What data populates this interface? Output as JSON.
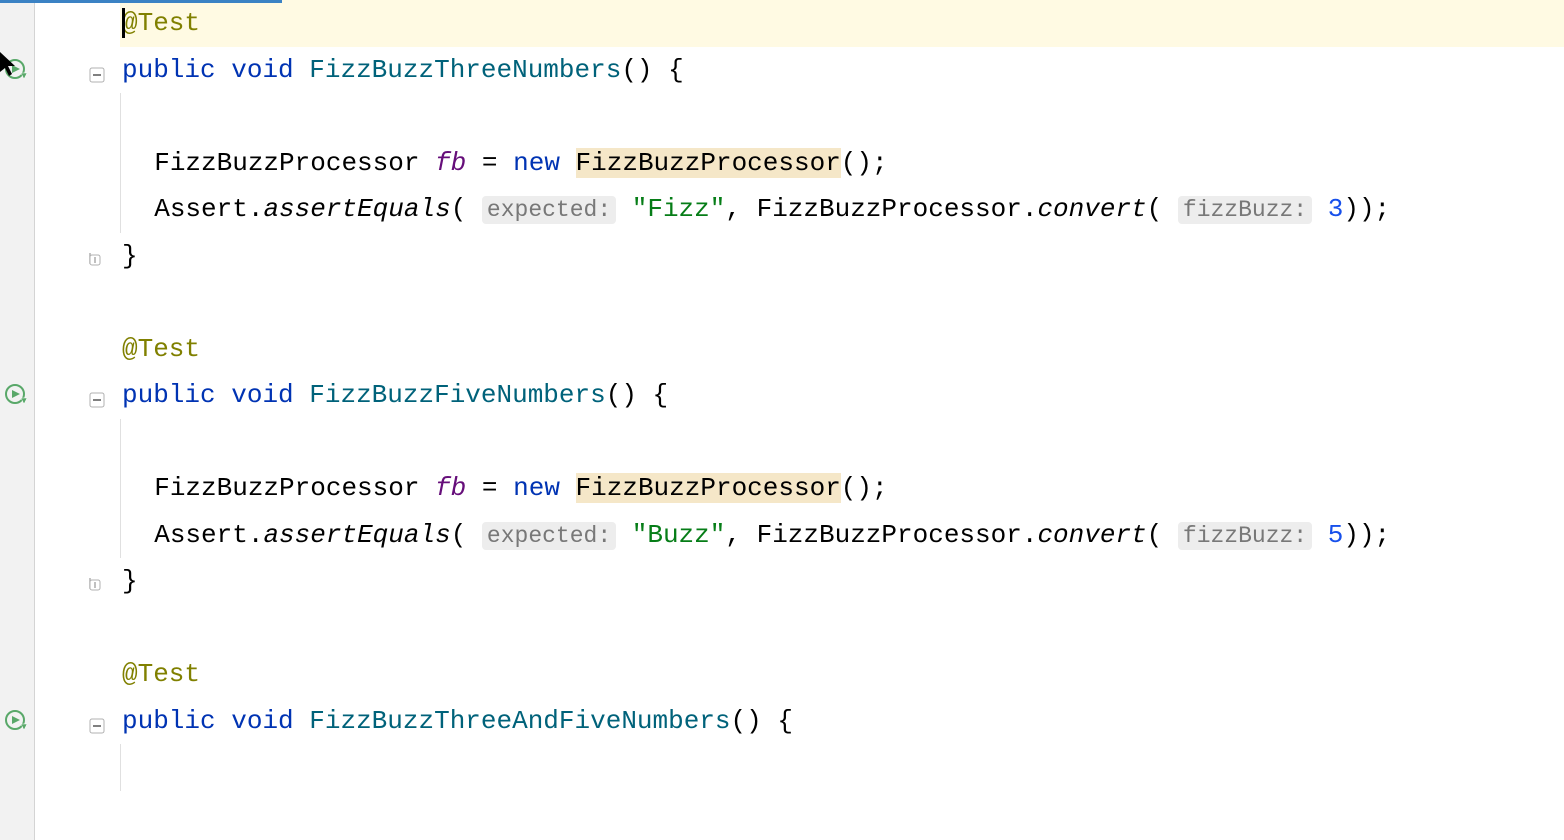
{
  "progress_percent": 18,
  "cursor_visible": true,
  "lines": [
    {
      "type": "annotation",
      "text": "@Test",
      "current": true,
      "caret": true,
      "indent": 0
    },
    {
      "type": "method_sig",
      "keywords": [
        "public",
        "void"
      ],
      "method": "FizzBuzzThreeNumbers",
      "suffix": "() {",
      "run_gutter": true,
      "fold_gutter": true,
      "bulb": true,
      "indent": 0
    },
    {
      "type": "blank",
      "indent": 1
    },
    {
      "type": "new_obj",
      "cls": "FizzBuzzProcessor",
      "var": "fb",
      "eq": "=",
      "kw": "new",
      "ctor": "FizzBuzzProcessor",
      "highlight_ctor": true,
      "suffix": "();",
      "indent": 1
    },
    {
      "type": "assert",
      "cls": "Assert",
      "method": "assertEquals",
      "hint1": "expected:",
      "str": "\"Fizz\"",
      "cls2": "FizzBuzzProcessor",
      "method2": "convert",
      "hint2": "fizzBuzz:",
      "num": "3",
      "suffix": "));",
      "indent": 1
    },
    {
      "type": "close_brace",
      "text": "}",
      "fold_end": true,
      "indent": 0
    },
    {
      "type": "blank",
      "indent": 0
    },
    {
      "type": "annotation",
      "text": "@Test",
      "indent": 0
    },
    {
      "type": "method_sig",
      "keywords": [
        "public",
        "void"
      ],
      "method": "FizzBuzzFiveNumbers",
      "suffix": "() {",
      "run_gutter": true,
      "fold_gutter": true,
      "indent": 0
    },
    {
      "type": "blank",
      "indent": 1
    },
    {
      "type": "new_obj",
      "cls": "FizzBuzzProcessor",
      "var": "fb",
      "eq": "=",
      "kw": "new",
      "ctor": "FizzBuzzProcessor",
      "highlight_ctor": true,
      "suffix": "();",
      "indent": 1
    },
    {
      "type": "assert",
      "cls": "Assert",
      "method": "assertEquals",
      "hint1": "expected:",
      "str": "\"Buzz\"",
      "cls2": "FizzBuzzProcessor",
      "method2": "convert",
      "hint2": "fizzBuzz:",
      "num": "5",
      "suffix": "));",
      "indent": 1
    },
    {
      "type": "close_brace",
      "text": "}",
      "fold_end": true,
      "indent": 0
    },
    {
      "type": "blank",
      "indent": 0
    },
    {
      "type": "annotation",
      "text": "@Test",
      "indent": 0
    },
    {
      "type": "method_sig",
      "keywords": [
        "public",
        "void"
      ],
      "method": "FizzBuzzThreeAndFiveNumbers",
      "suffix": "() {",
      "run_gutter": true,
      "fold_gutter": true,
      "indent": 0
    },
    {
      "type": "blank",
      "indent": 1
    }
  ]
}
